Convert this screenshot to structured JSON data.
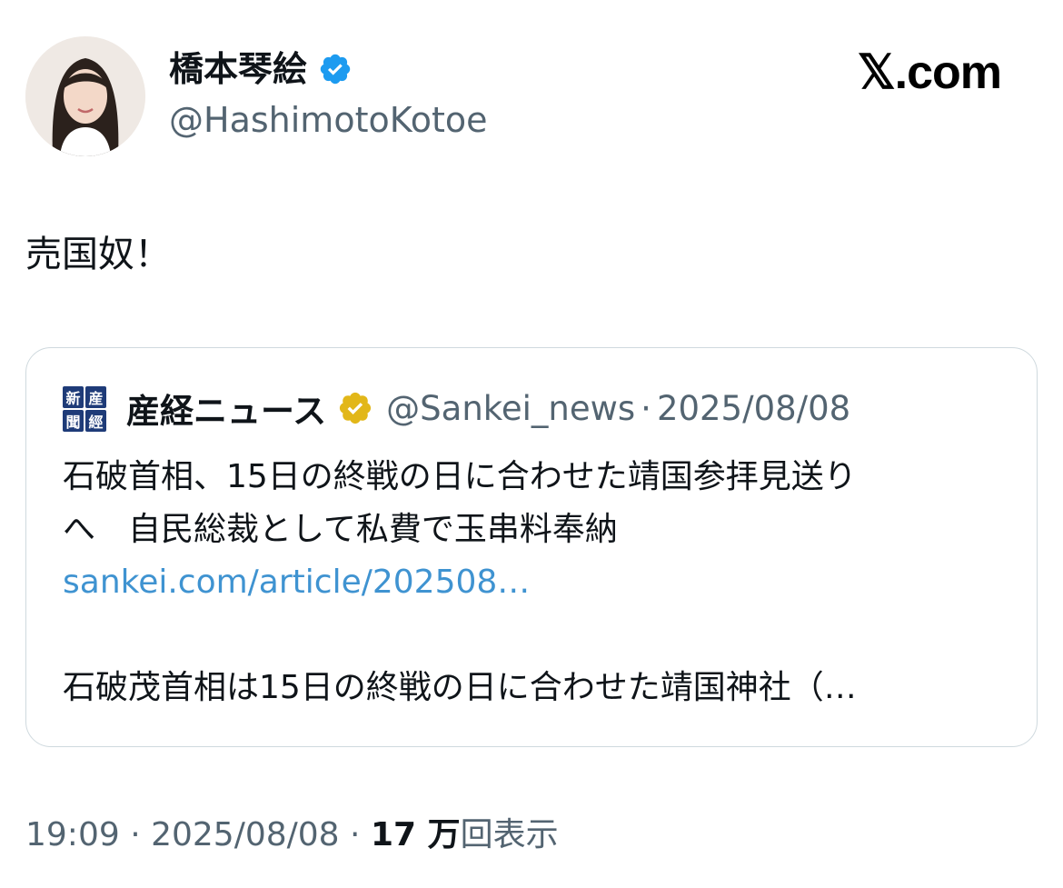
{
  "author": {
    "display_name": "橋本琴絵",
    "handle": "@HashimotoKotoe",
    "verified_badge_icon": "verified-check-icon",
    "badge_color": "#1d9bf0"
  },
  "site_logo": "𝕏.com",
  "tweet": {
    "text": "売国奴！"
  },
  "quoted_tweet": {
    "account_name": "産経ニュース",
    "logo_glyphs": [
      "新",
      "産",
      "聞",
      "經"
    ],
    "badge_icon": "gold-verified-check-icon",
    "badge_color": "#e2b719",
    "handle": "@Sankei_news",
    "separator": "·",
    "date": "2025/08/08",
    "headline_line1": "石破首相、15日の終戦の日に合わせた靖国参拝見送り",
    "headline_line2": "へ　自民総裁として私費で玉串料奉納",
    "link": "sankei.com/article/202508…",
    "summary": "石破茂首相は15日の終戦の日に合わせた靖国神社（…"
  },
  "meta": {
    "time": "19:09",
    "sep1": " · ",
    "date": "2025/08/08",
    "sep2": " · ",
    "views_count": "17 万",
    "views_label": "回表示"
  }
}
